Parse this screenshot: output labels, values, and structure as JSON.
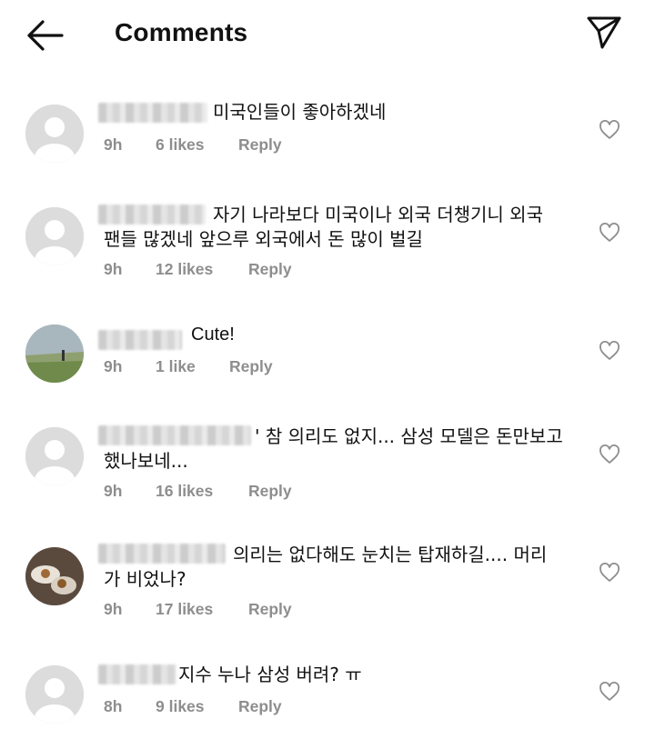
{
  "header": {
    "title": "Comments",
    "back_icon": "arrow-left-icon",
    "share_icon": "paper-plane-icon"
  },
  "comments": [
    {
      "text_lines": [
        "미국인들이  좋아하겠네"
      ],
      "time": "9h",
      "likes": "6 likes",
      "reply": "Reply",
      "avatar": "default-avatar"
    },
    {
      "text_lines": [
        "자기 나라보다  미국이나 외국 더챙기니  외국",
        "팬들 많겠네 앞으루 외국에서  돈 많이 벌길"
      ],
      "time": "9h",
      "likes": "12 likes",
      "reply": "Reply",
      "avatar": "default-avatar"
    },
    {
      "text_lines": [
        "Cute!"
      ],
      "time": "9h",
      "likes": "1 like",
      "reply": "Reply",
      "avatar": "photo-landscape-avatar"
    },
    {
      "text_lines": [
        "' 참 의리도 없지... 삼성 모델은 돈만보고",
        "했나보네..."
      ],
      "time": "9h",
      "likes": "16 likes",
      "reply": "Reply",
      "avatar": "default-avatar"
    },
    {
      "text_lines": [
        "의리는 없다해도 눈치는 탑재하길.... 머리",
        "가 비었나?"
      ],
      "time": "9h",
      "likes": "17 likes",
      "reply": "Reply",
      "avatar": "photo-food-avatar"
    },
    {
      "text_lines": [
        "지수 누나 삼성 버려? ㅠ"
      ],
      "time": "8h",
      "likes": "9 likes",
      "reply": "Reply",
      "avatar": "default-avatar"
    }
  ],
  "colors": {
    "meta": "#8e8e8e",
    "avatar_bg": "#dcdcdc",
    "heart": "#8e8e8e"
  }
}
